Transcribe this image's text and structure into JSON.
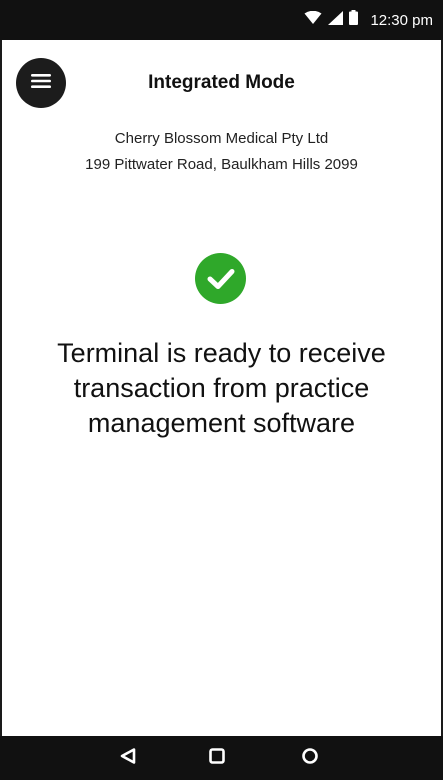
{
  "status_bar": {
    "time": "12:30 pm",
    "icons": [
      "wifi-icon",
      "signal-icon",
      "battery-icon"
    ]
  },
  "header": {
    "menu_icon": "hamburger-menu-icon",
    "title": "Integrated Mode"
  },
  "merchant": {
    "name": "Cherry Blossom Medical Pty Ltd",
    "address": "199 Pittwater Road, Baulkham Hills 2099"
  },
  "status": {
    "icon": "check-circle-icon",
    "message": "Terminal is ready to receive transaction from practice management software"
  },
  "navigation": {
    "buttons": [
      "back-icon",
      "home-icon",
      "recents-icon"
    ]
  },
  "colors": {
    "status_bar": "#111111",
    "nav_bar": "#111111",
    "success": "#2fa82a",
    "menu_button": "#1c1c1c"
  }
}
